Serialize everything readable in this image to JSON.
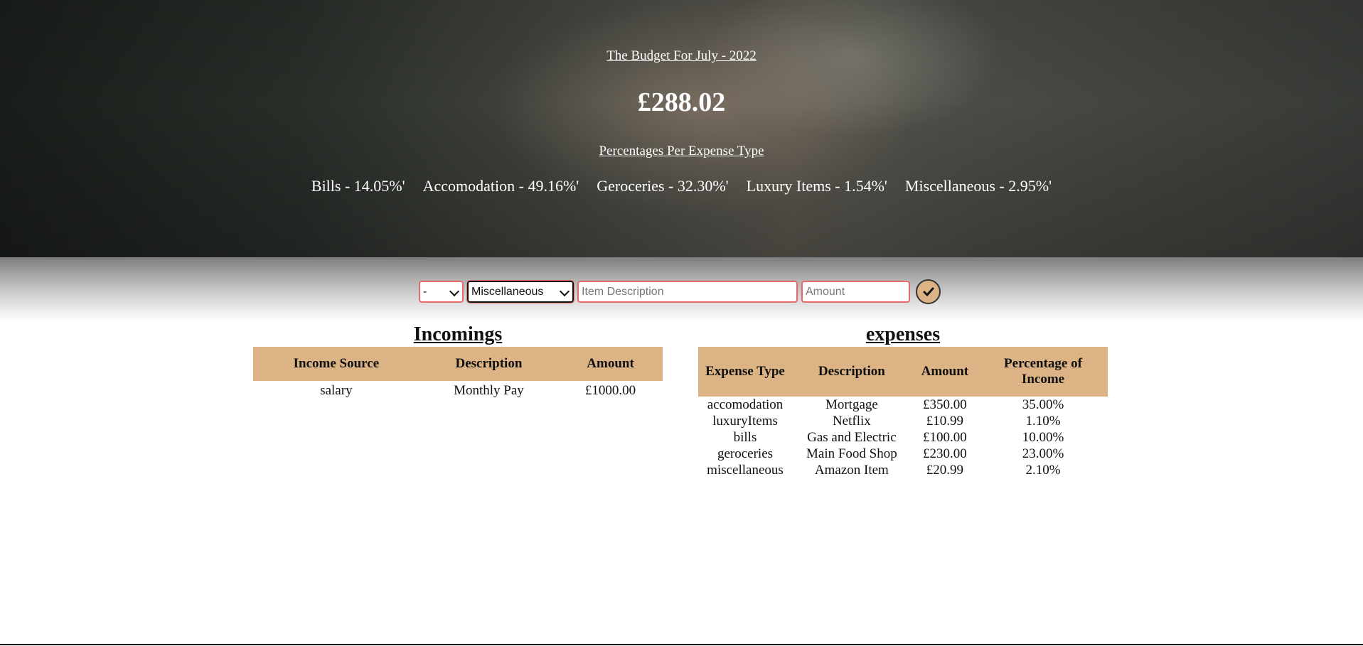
{
  "header": {
    "budget_title": "The Budget For July - 2022",
    "budget_total": "£288.02",
    "percentages_heading": "Percentages Per Expense Type",
    "percentages": [
      "Bills - 14.05%'",
      "Accomodation - 49.16%'",
      "Gerocerie‌s - 32.30%'",
      "Luxury Items - 1.54%'",
      "Miscellaneous - 2.95%'"
    ]
  },
  "form": {
    "type_select_value": "-",
    "category_select_value": "Miscellaneous",
    "description_placeholder": "Item Description",
    "amount_placeholder": "Amount",
    "submit_icon": "checkmark-icon"
  },
  "incomings": {
    "title": "Incomings",
    "headers": [
      "Income Source",
      "Description",
      "Amount"
    ],
    "rows": [
      [
        "salary",
        "Monthly Pay",
        "£1000.00"
      ]
    ]
  },
  "expenses": {
    "title": "expenses",
    "headers": [
      "Expense Type",
      "Description",
      "Amount",
      "Percentage of Income"
    ],
    "rows": [
      [
        "accomodation",
        "Mortgage",
        "£350.00",
        "35.00%"
      ],
      [
        "luxuryItems",
        "Netflix",
        "£10.99",
        "1.10%"
      ],
      [
        "bills",
        "Gas and Electric",
        "£100.00",
        "10.00%"
      ],
      [
        "gerocerie‌s",
        "Main Food Shop",
        "£230.00",
        "23.00%"
      ],
      [
        "miscellaneous",
        "Amazon Item",
        "£20.99",
        "2.10%"
      ]
    ]
  },
  "colors": {
    "table_header": "#dcb384",
    "input_border": "#e66a6a"
  }
}
